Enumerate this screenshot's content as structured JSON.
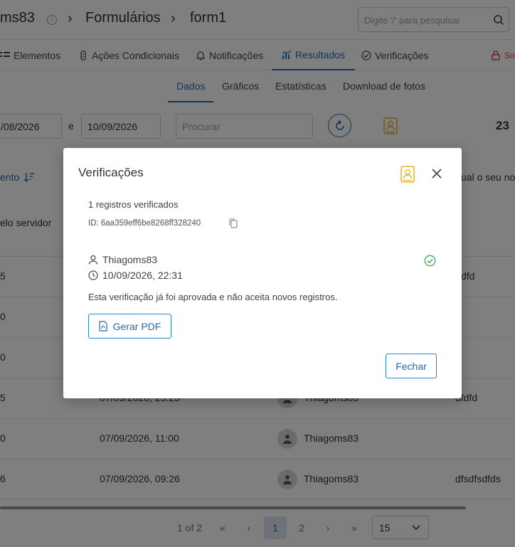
{
  "breadcrumb": {
    "user": "ms83",
    "section": "Formulários",
    "form": "form1"
  },
  "search": {
    "placeholder": "Digite '/' para pesquisar"
  },
  "tabs": [
    {
      "label": "Elementos"
    },
    {
      "label": "Ações Condicionais"
    },
    {
      "label": "Notificações"
    },
    {
      "label": "Resultados"
    },
    {
      "label": "Verificações"
    },
    {
      "label": "So"
    }
  ],
  "subtabs": [
    {
      "label": "Dados"
    },
    {
      "label": "Gráficos"
    },
    {
      "label": "Estatísticas"
    },
    {
      "label": "Download de fotos"
    }
  ],
  "filters": {
    "date_from": "/08/2026",
    "connector": "e",
    "date_to": "10/09/2026",
    "search_placeholder": "Procurar",
    "count": "23"
  },
  "table": {
    "col1_header": "ento",
    "col1_subheader": "elo servidor",
    "col4_header": "ual o seu no",
    "rows": [
      {
        "c1": "5",
        "date": "",
        "user": "",
        "c4": "dfd"
      },
      {
        "c1": "0",
        "date": "",
        "user": "",
        "c4": ""
      },
      {
        "c1": "0",
        "date": "",
        "user": "",
        "c4": ""
      },
      {
        "c1": "5",
        "date": "07/09/2026, 23:23",
        "user": "Thiagoms83",
        "c4": "dfdfd"
      },
      {
        "c1": "0",
        "date": "07/09/2026, 11:00",
        "user": "Thiagoms83",
        "c4": ""
      },
      {
        "c1": "6",
        "date": "07/09/2026, 09:26",
        "user": "Thiagoms83",
        "c4": "dfsdfsdfds"
      }
    ]
  },
  "pagination": {
    "summary": "1 of 2",
    "pages": [
      "1",
      "2"
    ],
    "page_size": "15"
  },
  "modal": {
    "title": "Verificações",
    "records_text": "1 registros verificados",
    "id_text": "ID: 6aa359eff6be8268ff328240",
    "user": "Thiagoms83",
    "datetime": "10/09/2026, 22:31",
    "message": "Esta verificação já foi aprovada e não aceita novos registros.",
    "pdf_label": "Gerar PDF",
    "close_label": "Fechar"
  },
  "colors": {
    "accent": "#1e6bb8",
    "badge": "#e7b324",
    "success": "#3aaa5c",
    "danger": "#d9363e"
  }
}
